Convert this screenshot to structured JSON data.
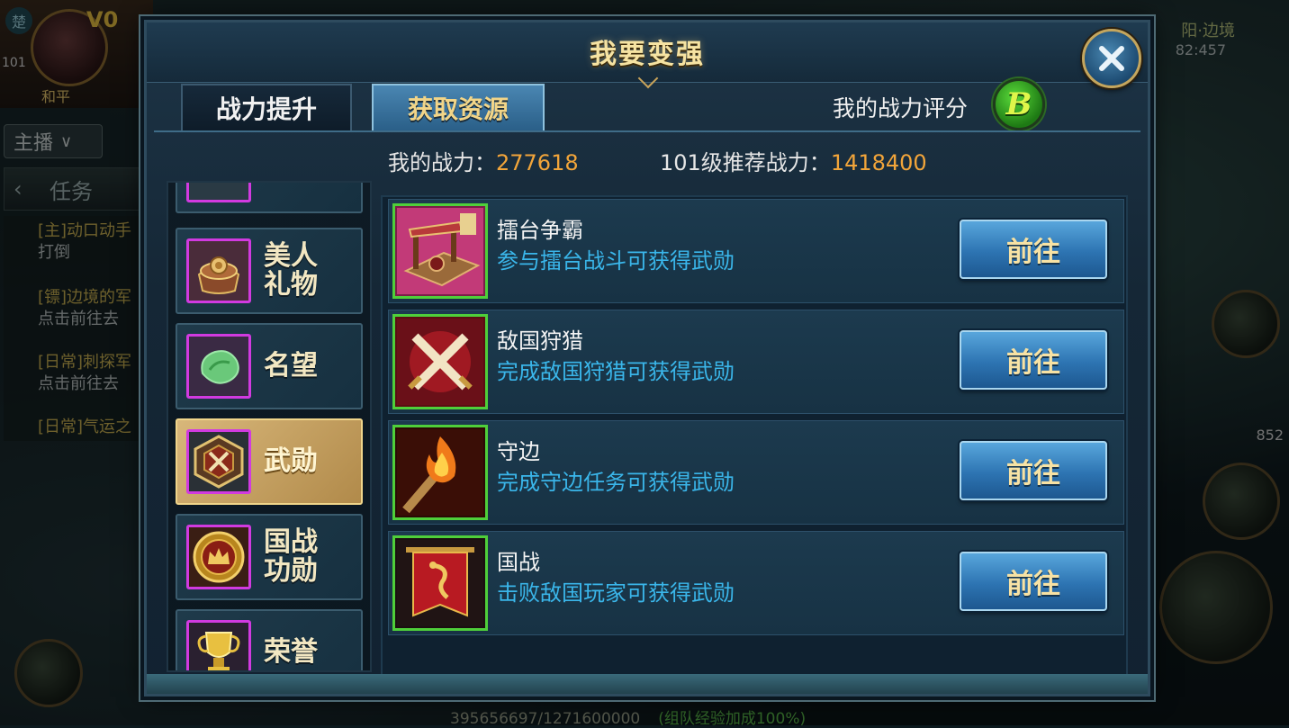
{
  "background": {
    "faction": "楚",
    "vip": "V0",
    "level": "101",
    "mode": "和平",
    "broadcast": "主播",
    "task_tab": "任务",
    "tasks": [
      {
        "line1": "[主]动口动手",
        "line2": "打倒",
        "color": "#d8c05a"
      },
      {
        "line1": "[镖]边境的军",
        "line2": "点击前往去",
        "color": "#d8c05a"
      },
      {
        "line1": "[日常]刺探军",
        "line2": "点击前往去",
        "color": "#d8c05a"
      },
      {
        "line1": "[日常]气运之",
        "line2": "",
        "color": "#d8c05a"
      }
    ],
    "map_name": "阳·边境",
    "coords": "82:457",
    "item_count": "852",
    "exp_text": "395656697/1271600000",
    "exp_bonus": "(组队经验加成100%)"
  },
  "dialog": {
    "title": "我要变强",
    "tabs": [
      {
        "label": "战力提升",
        "active": false
      },
      {
        "label": "获取资源",
        "active": true
      }
    ],
    "rating_label": "我的战力评分",
    "rating_grade": "B",
    "my_power_label": "我的战力：",
    "my_power_value": "277618",
    "recommend_label": "101级推荐战力：",
    "recommend_value": "1418400"
  },
  "categories": [
    {
      "label": "",
      "icon": "scroll-icon",
      "selected": false
    },
    {
      "label": "美人礼物",
      "icon": "gift-box-icon",
      "selected": false
    },
    {
      "label": "名望",
      "icon": "jade-icon",
      "selected": false
    },
    {
      "label": "武勋",
      "icon": "crossed-swords-badge-icon",
      "selected": true
    },
    {
      "label": "国战功勋",
      "icon": "crown-medal-icon",
      "selected": false
    },
    {
      "label": "荣誉",
      "icon": "trophy-icon",
      "selected": false
    }
  ],
  "resources": [
    {
      "name": "擂台争霸",
      "desc": "参与擂台战斗可获得武勋",
      "button": "前往",
      "icon": "arena-stage-icon"
    },
    {
      "name": "敌国狩猎",
      "desc": "完成敌国狩猎可获得武勋",
      "button": "前往",
      "icon": "crossed-swords-icon"
    },
    {
      "name": "守边",
      "desc": "完成守边任务可获得武勋",
      "button": "前往",
      "icon": "torch-icon"
    },
    {
      "name": "国战",
      "desc": "击败敌国玩家可获得武勋",
      "button": "前往",
      "icon": "dragon-banner-icon"
    }
  ],
  "colors": {
    "accent_gold": "#f2a53a",
    "desc_blue": "#3ab6ea",
    "icon_border_green": "#4fcf3a",
    "icon_border_magenta": "#d13ae0",
    "rating_green": "#3ab82a"
  }
}
